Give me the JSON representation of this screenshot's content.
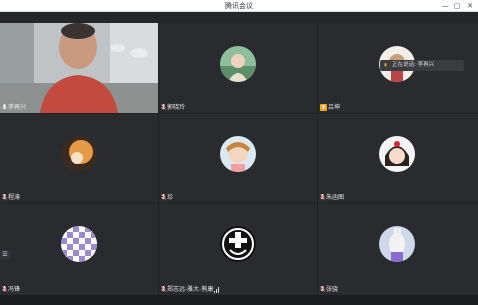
{
  "window": {
    "title": "腾讯会议",
    "min_glyph": "—",
    "max_glyph": "▢",
    "close_glyph": "✕"
  },
  "tooltip": {
    "text": "正在说话: 李再兴"
  },
  "menu_glyph": "☰",
  "participants": [
    {
      "name": "李再兴",
      "mic": "unmuted"
    },
    {
      "name": "郭晓玲",
      "mic": "muted"
    },
    {
      "name": "吕坤",
      "mic": "speaking"
    },
    {
      "name": "程涛",
      "mic": "muted"
    },
    {
      "name": "珍",
      "mic": "muted"
    },
    {
      "name": "朱函图",
      "mic": "muted"
    },
    {
      "name": "冯锋",
      "mic": "muted"
    },
    {
      "name": "郑志远-雅大-熊康",
      "mic": "muted"
    },
    {
      "name": "张骁",
      "mic": "muted"
    }
  ],
  "colors": {
    "tile_bg": "#2a2b2e",
    "grid_bg": "#202124",
    "speaking_orange": "#f5a623"
  }
}
